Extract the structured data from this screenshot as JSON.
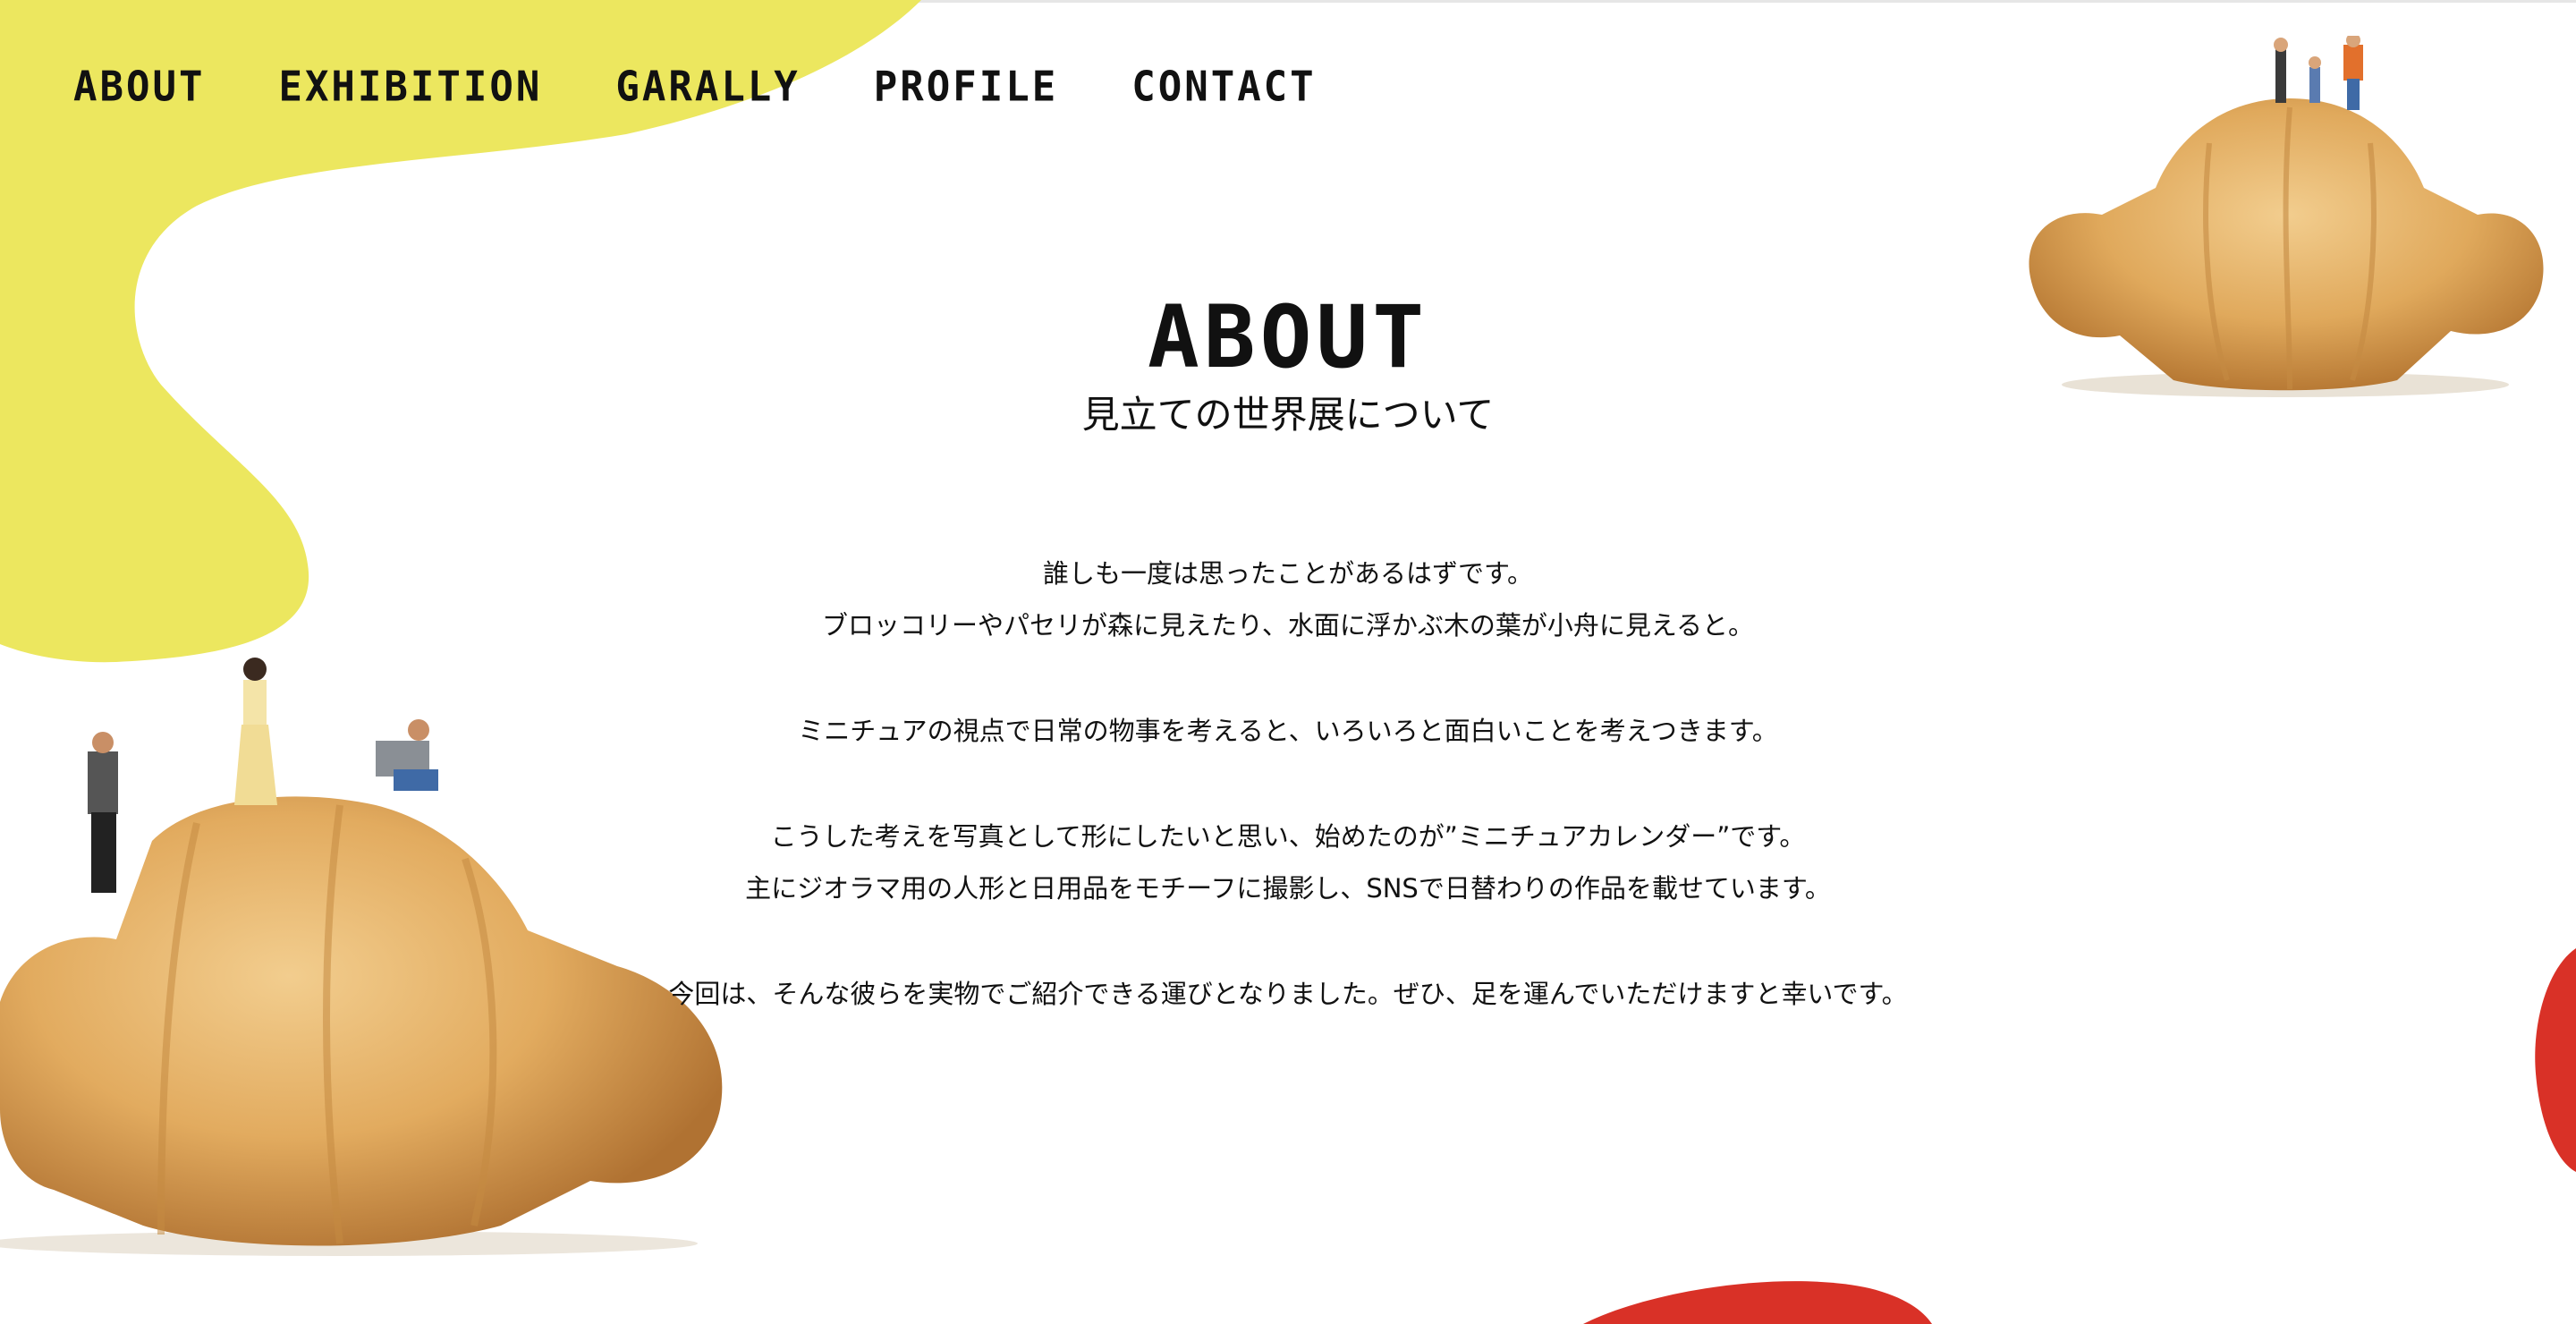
{
  "nav": {
    "items": [
      {
        "label": "ABOUT"
      },
      {
        "label": "EXHIBITION"
      },
      {
        "label": "GARALLY"
      },
      {
        "label": "PROFILE"
      },
      {
        "label": "CONTACT"
      }
    ]
  },
  "heading": {
    "title": "ABOUT",
    "subtitle": "見立ての世界展について"
  },
  "body": {
    "paragraphs": [
      {
        "lines": [
          "誰しも一度は思ったことがあるはずです。",
          "ブロッコリーやパセリが森に見えたり、水面に浮かぶ木の葉が小舟に見えると。"
        ]
      },
      {
        "lines": [
          "ミニチュアの視点で日常の物事を考えると、いろいろと面白いことを考えつきます。"
        ]
      },
      {
        "lines": [
          "こうした考えを写真として形にしたいと思い、始めたのが”ミニチュアカレンダー”です。",
          "主にジオラマ用の人形と日用品をモチーフに撮影し、SNSで日替わりの作品を載せています。"
        ]
      },
      {
        "lines": [
          "今回は、そんな彼らを実物でご紹介できる運びとなりました。ぜひ、足を運んでいただけますと幸いです。"
        ]
      }
    ]
  },
  "colors": {
    "accent_yellow": "#ece75f",
    "accent_red": "#d93127",
    "bread_light": "#eab96f",
    "bread_dark": "#c58a42"
  },
  "decor": {
    "left_image": "croissant-with-miniature-figures",
    "right_image": "croissant-with-miniature-family"
  }
}
